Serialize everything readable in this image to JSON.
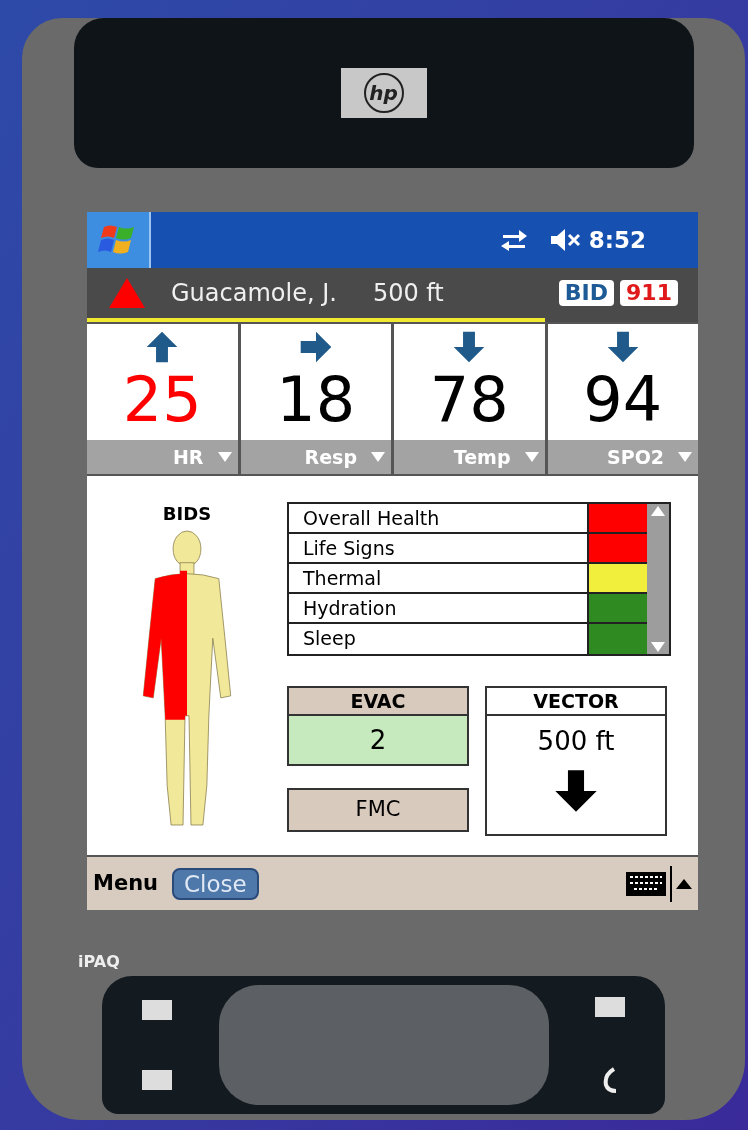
{
  "device": {
    "logo": "hp",
    "model": "iPAQ"
  },
  "status_bar": {
    "time": "8:52"
  },
  "patient": {
    "alert": true,
    "name": "Guacamole, J.",
    "distance": "500 ft",
    "badges": [
      {
        "label": "BID",
        "color": "#1d5a96"
      },
      {
        "label": "911",
        "color": "#e01a1a"
      }
    ],
    "signal": {
      "level": 0.75
    }
  },
  "vitals": [
    {
      "kind": "rising",
      "value": "25",
      "alert": true,
      "label": "HR"
    },
    {
      "kind": "steady",
      "value": "18",
      "alert": false,
      "label": "Resp"
    },
    {
      "kind": "falling",
      "value": "78",
      "alert": false,
      "label": "Temp"
    },
    {
      "kind": "falling",
      "value": "94",
      "alert": false,
      "label": "SPO2"
    }
  ],
  "bids": {
    "title": "BIDS"
  },
  "status_list": [
    {
      "label": "Overall Health",
      "color": "#ff0000"
    },
    {
      "label": "Life Signs",
      "color": "#ff0000"
    },
    {
      "label": "Thermal",
      "color": "#f2ee3c"
    },
    {
      "label": "Hydration",
      "color": "#2f8a22"
    },
    {
      "label": "Sleep",
      "color": "#2f8a22"
    }
  ],
  "evac": {
    "title": "EVAC",
    "value": "2"
  },
  "fmc_button": "FMC",
  "vector": {
    "title": "VECTOR",
    "distance": "500 ft"
  },
  "menu_bar": {
    "menu": "Menu",
    "close": "Close"
  }
}
